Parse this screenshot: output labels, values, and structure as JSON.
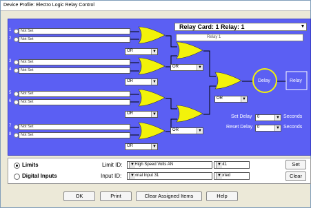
{
  "window": {
    "title": "Device Profile: Electro Logic Relay Control"
  },
  "inputs": [
    {
      "num": "1",
      "value": "Not Set"
    },
    {
      "num": "2",
      "value": "Not Set"
    },
    {
      "num": "3",
      "value": "Not Set"
    },
    {
      "num": "4",
      "value": "Not Set"
    },
    {
      "num": "5",
      "value": "Not Set"
    },
    {
      "num": "6",
      "value": "Not Set"
    },
    {
      "num": "7",
      "value": "Not Set"
    },
    {
      "num": "8",
      "value": "Not Set"
    }
  ],
  "gates": {
    "stage1": [
      "OR",
      "OR",
      "OR",
      "OR"
    ],
    "stage2": [
      "OR",
      "OR"
    ],
    "stage3": "OR"
  },
  "relay": {
    "header": "Relay Card: 1 Relay: 1",
    "name": "Relay 1",
    "delay_node": "Delay",
    "relay_node": "Relay",
    "set_delay_label": "Set Delay",
    "set_delay_value": "0",
    "reset_delay_label": "Reset Delay",
    "reset_delay_value": "0",
    "seconds": "Seconds"
  },
  "colors": {
    "canvas": "#5b5ff3",
    "gate": "#f2f20a",
    "delay_ring": "#f2f20a"
  },
  "limits": {
    "label": "Limits",
    "limit_id_label": "Limit ID:",
    "limit_id_value": "01:High Speed Volts AN",
    "limit_select": "Limit1",
    "set_button": "Set"
  },
  "digital": {
    "label": "Digital Inputs",
    "input_id_label": "Input ID:",
    "input_id_value": "Internal Input 31",
    "state_select": "Shorted",
    "clear_button": "Clear"
  },
  "footer": {
    "ok": "OK",
    "print": "Print",
    "clear_assigned": "Clear Assigned Items",
    "help": "Help"
  }
}
